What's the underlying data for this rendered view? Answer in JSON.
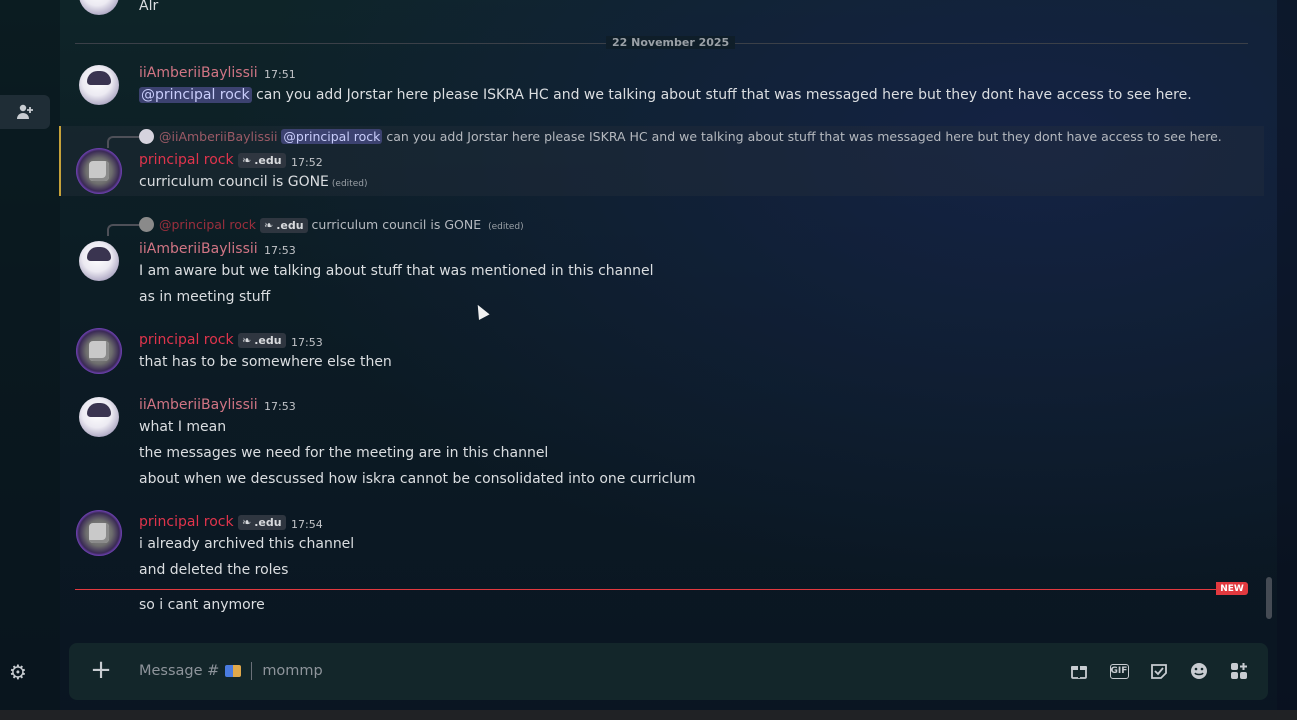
{
  "date_divider": "22 November 2025",
  "top_partial": {
    "text": "Alr"
  },
  "messages": [
    {
      "user": "iiAmberiiBaylissii",
      "time": "17:51",
      "mention": "@principal rock",
      "lines": [
        "can you add Jorstar here please ISKRA HC and we talking about stuff that was messaged here but they dont have access to see here."
      ]
    },
    {
      "reply_to": {
        "user": "@iiAmberiiBaylissii",
        "mention": "@principal rock",
        "text": "can you add Jorstar here please ISKRA HC and we talking about stuff that was messaged here but they dont have access to see here."
      },
      "user": "principal rock",
      "tag": ".edu",
      "time": "17:52",
      "lines": [
        "curriculum council is GONE"
      ],
      "edited": "(edited)"
    },
    {
      "reply_to": {
        "user": "@principal rock",
        "tag": ".edu",
        "text": "curriculum council is GONE",
        "edited": "(edited)"
      },
      "user": "iiAmberiiBaylissii",
      "time": "17:53",
      "lines": [
        "I am aware but we talking about stuff that was mentioned in this channel",
        "as in meeting stuff"
      ]
    },
    {
      "user": "principal rock",
      "tag": ".edu",
      "time": "17:53",
      "lines": [
        "that has to be somewhere else then"
      ]
    },
    {
      "user": "iiAmberiiBaylissii",
      "time": "17:53",
      "lines": [
        "what I mean",
        "the messages we need for the meeting are in this channel",
        "about when we descussed how iskra cannot be consolidated into one curriclum"
      ]
    },
    {
      "user": "principal rock",
      "tag": ".edu",
      "time": "17:54",
      "lines": [
        "i already archived this channel",
        "and deleted the roles",
        "so i cant anymore"
      ]
    }
  ],
  "new_badge": "NEW",
  "composer": {
    "placeholder": "Message #",
    "channel": "mommp"
  },
  "icons": [
    "add-member-icon",
    "gear-icon",
    "plus-icon",
    "gift-icon",
    "gif-icon",
    "sticker-icon",
    "emoji-icon",
    "apps-icon"
  ],
  "colors": {
    "amber_name": "#d17584",
    "rock_name": "#e0344c",
    "new_line": "#e2393f",
    "mention_bg": "#3c4270"
  }
}
